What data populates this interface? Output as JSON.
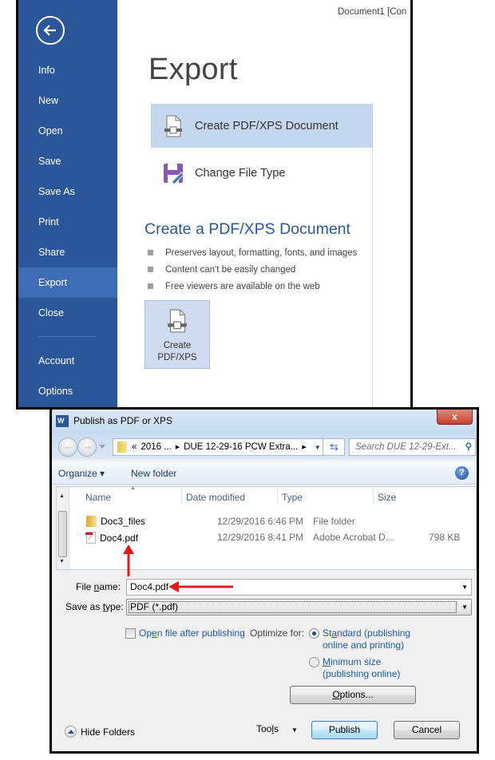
{
  "backstage": {
    "document_title": "Document1 [Con",
    "nav_items": [
      {
        "label": "Info",
        "active": false
      },
      {
        "label": "New",
        "active": false
      },
      {
        "label": "Open",
        "active": false
      },
      {
        "label": "Save",
        "active": false
      },
      {
        "label": "Save As",
        "active": false
      },
      {
        "label": "Print",
        "active": false
      },
      {
        "label": "Share",
        "active": false
      },
      {
        "label": "Export",
        "active": true
      },
      {
        "label": "Close",
        "active": false
      },
      {
        "label": "Account",
        "active": false
      },
      {
        "label": "Options",
        "active": false
      }
    ],
    "page_title": "Export",
    "options": [
      {
        "label": "Create PDF/XPS Document",
        "icon": "pdf-document-icon",
        "selected": true
      },
      {
        "label": "Change File Type",
        "icon": "change-file-type-icon",
        "selected": false
      }
    ],
    "section_title": "Create a PDF/XPS Document",
    "bullets": [
      "Preserves layout, formatting, fonts, and images",
      "Content can't be easily changed",
      "Free viewers are available on the web"
    ],
    "create_button": {
      "line1": "Create",
      "line2": "PDF/XPS"
    },
    "colors": {
      "sidebar": "#2b579a",
      "sidebar_active": "#3e6db5",
      "selected_option": "#c5d7ef",
      "accent_text": "#2b579a"
    }
  },
  "dialog": {
    "title": "Publish as PDF or XPS",
    "close_label": "x",
    "address": {
      "prefix": "«",
      "crumb1": "2016 ...",
      "crumb2": "DUE 12-29-16 PCW Extra..."
    },
    "search_placeholder": "Search DUE 12-29-Ext...",
    "toolbar": {
      "organize": "Organize ▾",
      "new_folder": "New folder"
    },
    "columns": [
      "Name",
      "Date modified",
      "Type",
      "Size"
    ],
    "files": [
      {
        "name": "Doc3_files",
        "date": "12/29/2016 6:46 PM",
        "type": "File folder",
        "size": "",
        "icon": "folder-icon"
      },
      {
        "name": "Doc4.pdf",
        "date": "12/29/2016 8:41 PM",
        "type": "Adobe Acrobat D...",
        "size": "798 KB",
        "icon": "pdf-file-icon"
      }
    ],
    "file_name": {
      "label_pre": "File ",
      "label_u": "n",
      "label_post": "ame:",
      "value": "Doc4.pdf"
    },
    "save_type": {
      "label_pre": "Save as ",
      "label_u": "t",
      "label_post": "ype:",
      "value": "PDF (*.pdf)"
    },
    "open_after": {
      "pre": "Op",
      "u": "e",
      "post": "n file after publishing",
      "checked": false
    },
    "optimize_label": "Optimize for:",
    "radio_standard": {
      "pre": "St",
      "u": "a",
      "post": "ndard (publishing",
      "line2": "online and printing)",
      "checked": true
    },
    "radio_minimum": {
      "pre": "",
      "u": "M",
      "post": "inimum size",
      "line2": "(publishing online)",
      "checked": false
    },
    "options_button": {
      "u": "O",
      "post": "ptions..."
    },
    "hide_folders": "Hide Folders",
    "tools": {
      "pre": "Too",
      "u": "l",
      "post": "s"
    },
    "publish_button": "Publish",
    "cancel_button": "Cancel",
    "annotation_color": "#e21b1b"
  }
}
